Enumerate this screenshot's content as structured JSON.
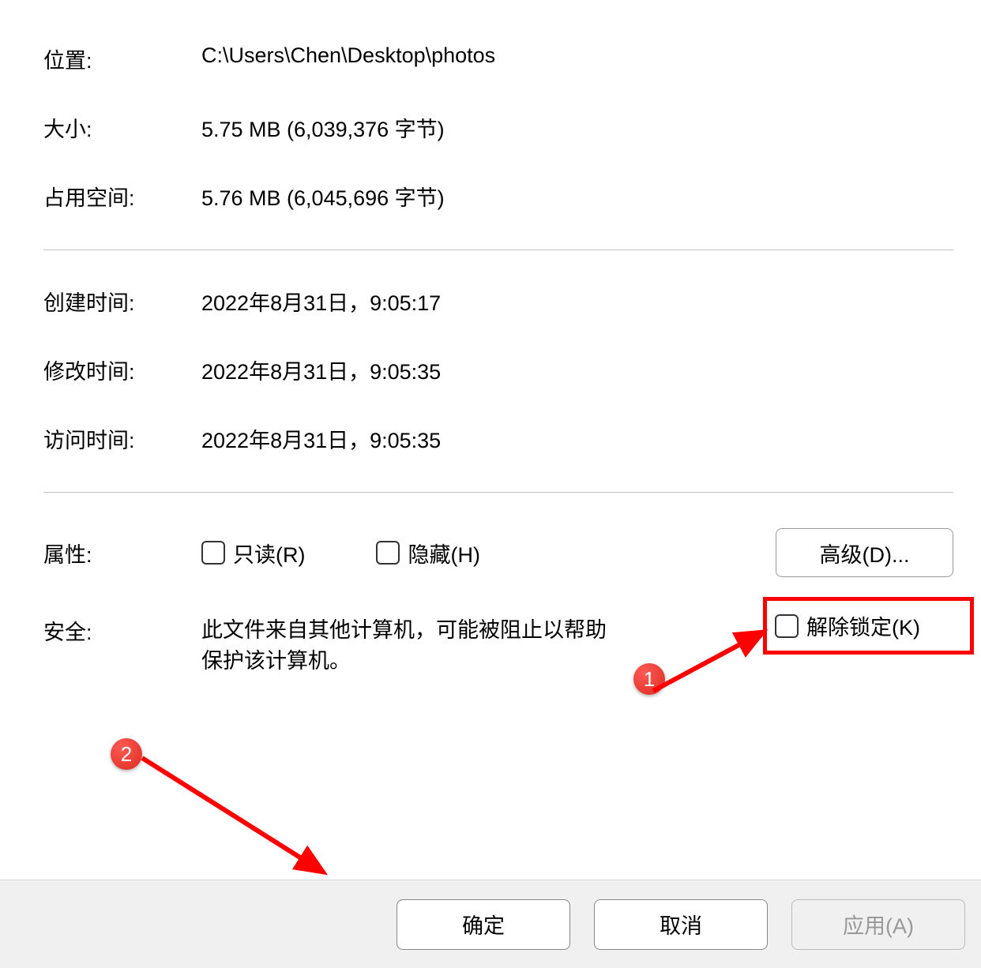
{
  "fields": {
    "location": {
      "label": "位置:",
      "value": "C:\\Users\\Chen\\Desktop\\photos"
    },
    "size": {
      "label": "大小:",
      "value": "5.75 MB (6,039,376 字节)"
    },
    "size_on_disk": {
      "label": "占用空间:",
      "value": "5.76 MB (6,045,696 字节)"
    },
    "created": {
      "label": "创建时间:",
      "value": "2022年8月31日，9:05:17"
    },
    "modified": {
      "label": "修改时间:",
      "value": "2022年8月31日，9:05:35"
    },
    "accessed": {
      "label": "访问时间:",
      "value": "2022年8月31日，9:05:35"
    }
  },
  "attributes": {
    "label": "属性:",
    "readonly": "只读(R)",
    "hidden": "隐藏(H)",
    "advanced": "高级(D)..."
  },
  "security": {
    "label": "安全:",
    "text": "此文件来自其他计算机，可能被阻止以帮助保护该计算机。",
    "unblock": "解除锁定(K)"
  },
  "buttons": {
    "ok": "确定",
    "cancel": "取消",
    "apply": "应用(A)"
  },
  "annotations": {
    "badge1": "1",
    "badge2": "2"
  }
}
